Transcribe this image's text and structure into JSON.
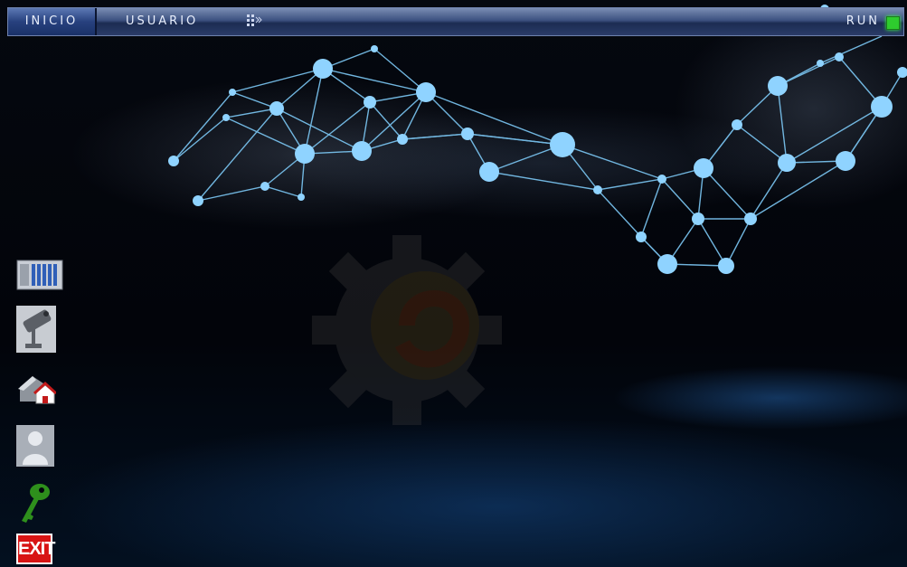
{
  "topbar": {
    "home_tab": "INICIO",
    "user_tab": "USUARIO",
    "run_label": "RUN",
    "run_led_color": "#2ecc2e"
  },
  "sidebar": {
    "items": [
      {
        "icon": "plc-rack-icon"
      },
      {
        "icon": "security-camera-icon"
      },
      {
        "icon": "home-return-icon"
      },
      {
        "icon": "user-icon"
      },
      {
        "icon": "key-icon"
      }
    ],
    "exit_label": "EXIT"
  },
  "colors": {
    "bar_blue": "#2a3c68",
    "network_blue": "#8fd3ff",
    "exit_red": "#d81414"
  }
}
